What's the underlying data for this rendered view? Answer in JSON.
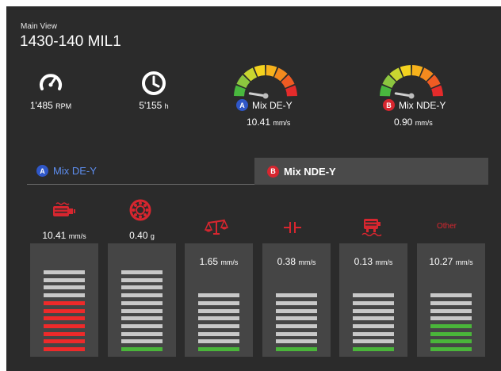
{
  "header": {
    "subtitle": "Main View",
    "title": "1430-140 MIL1"
  },
  "stats": {
    "rpm": {
      "value": "1'485",
      "unit": "RPM",
      "icon": "speedometer-icon"
    },
    "hours": {
      "value": "5'155",
      "unit": "h",
      "icon": "clock-icon"
    }
  },
  "gauges": [
    {
      "badge": "A",
      "label": "Mix DE-Y",
      "value": "10.41",
      "unit": "mm/s",
      "needle_level": 0.05
    },
    {
      "badge": "B",
      "label": "Mix NDE-Y",
      "value": "0.90",
      "unit": "mm/s",
      "needle_level": 0.05
    }
  ],
  "tabs": [
    {
      "badge": "A",
      "label": "Mix DE-Y",
      "active": false
    },
    {
      "badge": "B",
      "label": "Mix NDE-Y",
      "active": true
    }
  ],
  "categories": [
    {
      "icon": "motor-icon",
      "value": "10.41",
      "unit": "mm/s",
      "value_position": "above",
      "bars": [
        "grey",
        "grey",
        "grey",
        "grey",
        "red",
        "red",
        "red",
        "red",
        "red",
        "red",
        "red"
      ]
    },
    {
      "icon": "bearing-icon",
      "value": "0.40",
      "unit": "g",
      "value_position": "above",
      "bars": [
        "grey",
        "grey",
        "grey",
        "grey",
        "grey",
        "grey",
        "grey",
        "grey",
        "grey",
        "grey",
        "green"
      ]
    },
    {
      "icon": "balance-icon",
      "value": "1.65",
      "unit": "mm/s",
      "value_position": "inside",
      "bars": [
        "grey",
        "grey",
        "grey",
        "grey",
        "grey",
        "grey",
        "grey",
        "green"
      ]
    },
    {
      "icon": "alignment-icon",
      "value": "0.38",
      "unit": "mm/s",
      "value_position": "inside",
      "bars": [
        "grey",
        "grey",
        "grey",
        "grey",
        "grey",
        "grey",
        "grey",
        "green"
      ]
    },
    {
      "icon": "foundation-icon",
      "value": "0.13",
      "unit": "mm/s",
      "value_position": "inside",
      "bars": [
        "grey",
        "grey",
        "grey",
        "grey",
        "grey",
        "grey",
        "grey",
        "green"
      ]
    },
    {
      "icon": "other-icon",
      "label": "Other",
      "value": "10.27",
      "unit": "mm/s",
      "value_position": "inside",
      "bars": [
        "grey",
        "grey",
        "grey",
        "grey",
        "green",
        "green",
        "green",
        "green"
      ]
    }
  ],
  "colors": {
    "accent_blue": "#2f57c8",
    "accent_red": "#d7262f",
    "bar_green": "#4ab53a",
    "bar_red": "#ee2a2a"
  }
}
